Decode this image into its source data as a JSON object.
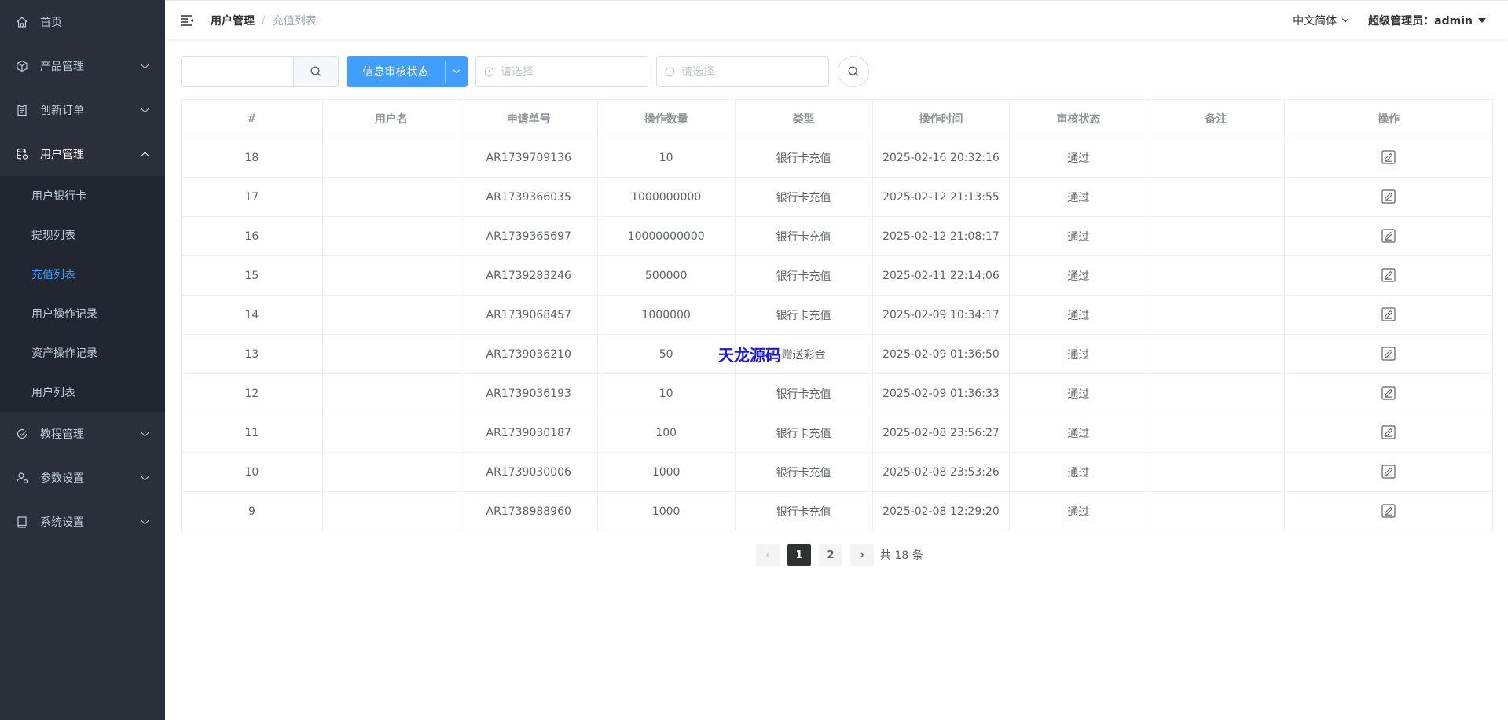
{
  "sidebar": {
    "items": [
      {
        "label": "首页",
        "icon": "home-icon",
        "has_children": false
      },
      {
        "label": "产品管理",
        "icon": "cube-icon",
        "has_children": true
      },
      {
        "label": "创新订单",
        "icon": "clipboard-icon",
        "has_children": true
      },
      {
        "label": "用户管理",
        "icon": "database-icon",
        "has_children": true,
        "expanded": true
      },
      {
        "label": "教程管理",
        "icon": "check-circle-icon",
        "has_children": true
      },
      {
        "label": "参数设置",
        "icon": "user-gear-icon",
        "has_children": true
      },
      {
        "label": "系统设置",
        "icon": "book-icon",
        "has_children": true
      }
    ],
    "sub_items": [
      "用户银行卡",
      "提现列表",
      "充值列表",
      "用户操作记录",
      "资产操作记录",
      "用户列表"
    ],
    "active_sub": "充值列表"
  },
  "header": {
    "breadcrumb": [
      "用户管理",
      "充值列表"
    ],
    "breadcrumb_sep": "/",
    "language": "中文简体",
    "user": "超级管理员：admin"
  },
  "filters": {
    "search_placeholder": "",
    "status_button": "信息审核状态",
    "date_start_placeholder": "请选择",
    "date_end_placeholder": "请选择"
  },
  "table": {
    "columns": [
      "#",
      "用户名",
      "申请单号",
      "操作数量",
      "类型",
      "操作时间",
      "审核状态",
      "备注",
      "操作"
    ],
    "rows": [
      [
        "18",
        "",
        "AR1739709136",
        "10",
        "银行卡充值",
        "2025-02-16 20:32:16",
        "通过",
        ""
      ],
      [
        "17",
        "",
        "AR1739366035",
        "1000000000",
        "银行卡充值",
        "2025-02-12 21:13:55",
        "通过",
        ""
      ],
      [
        "16",
        "",
        "AR1739365697",
        "10000000000",
        "银行卡充值",
        "2025-02-12 21:08:17",
        "通过",
        ""
      ],
      [
        "15",
        "",
        "AR1739283246",
        "500000",
        "银行卡充值",
        "2025-02-11 22:14:06",
        "通过",
        ""
      ],
      [
        "14",
        "",
        "AR1739068457",
        "1000000",
        "银行卡充值",
        "2025-02-09 10:34:17",
        "通过",
        ""
      ],
      [
        "13",
        "",
        "AR1739036210",
        "50",
        "赠送彩金",
        "2025-02-09 01:36:50",
        "通过",
        ""
      ],
      [
        "12",
        "",
        "AR1739036193",
        "10",
        "银行卡充值",
        "2025-02-09 01:36:33",
        "通过",
        ""
      ],
      [
        "11",
        "",
        "AR1739030187",
        "100",
        "银行卡充值",
        "2025-02-08 23:56:27",
        "通过",
        ""
      ],
      [
        "10",
        "",
        "AR1739030006",
        "1000",
        "银行卡充值",
        "2025-02-08 23:53:26",
        "通过",
        ""
      ],
      [
        "9",
        "",
        "AR1738988960",
        "1000",
        "银行卡充值",
        "2025-02-08 12:29:20",
        "通过",
        ""
      ]
    ]
  },
  "pagination": {
    "prev": "‹",
    "pages": [
      "1",
      "2"
    ],
    "current": "1",
    "next": "›",
    "total": "共 18 条"
  },
  "watermark": "天龙源码",
  "colors": {
    "sidebar_bg": "#2b2f3a",
    "accent": "#409eff",
    "watermark": "#1a1ae6"
  }
}
